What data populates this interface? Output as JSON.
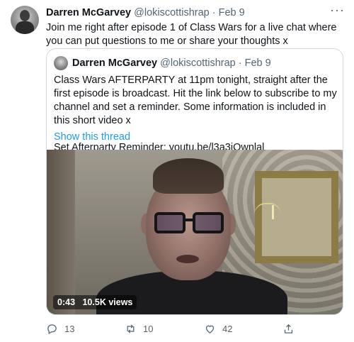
{
  "tweet": {
    "author_name": "Darren McGarvey",
    "author_handle": "@lokiscottishrap",
    "separator": "·",
    "date": "Feb 9",
    "more_label": "···",
    "text": "Join me right after episode 1 of Class Wars for a live chat where you can put questions to me or share your thoughts x"
  },
  "quote": {
    "author_name": "Darren McGarvey",
    "author_handle": "@lokiscottishrap",
    "separator": "·",
    "date": "Feb 9",
    "text_line1": "Class Wars AFTERPARTY at 11pm tonight, straight after the first episode is broadcast. Hit the link below to subscribe to my channel and set a reminder. Some information is included in this short video x",
    "text_line2": "Set Afterparty Reminder: youtu.be/l3a3jQwnlal",
    "show_thread": "Show this thread",
    "video": {
      "duration": "0:43",
      "views": "10.5K views"
    }
  },
  "actions": {
    "reply_count": "13",
    "retweet_count": "10",
    "like_count": "42"
  },
  "icons": [
    "reply-icon",
    "retweet-icon",
    "like-icon",
    "share-icon",
    "more-icon"
  ],
  "colors": {
    "link": "#1d9bf0",
    "secondary_text": "#536471",
    "border": "#cfd9de"
  }
}
